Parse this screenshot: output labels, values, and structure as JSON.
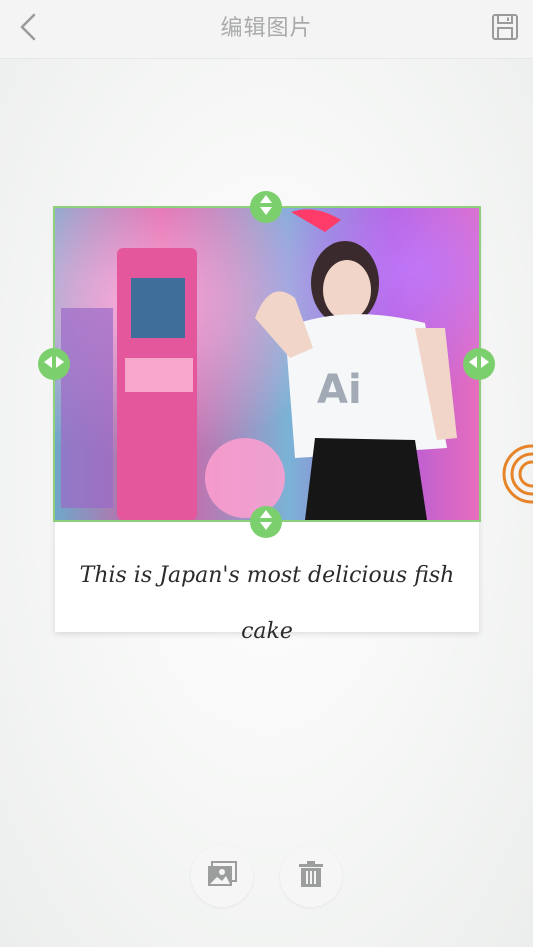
{
  "header": {
    "title": "编辑图片",
    "back_icon": "chevron-left-icon",
    "save_icon": "floppy-disk-icon"
  },
  "card": {
    "caption": "This is Japan's most delicious fish cake",
    "photo_description": "photo-content",
    "selection_color": "#8fd07c",
    "handle_color": "#7ccf6d"
  },
  "tools": [
    {
      "name": "replace-image",
      "icon": "image-icon"
    },
    {
      "name": "delete",
      "icon": "trash-icon"
    }
  ],
  "accent_orange": "#e7842a"
}
